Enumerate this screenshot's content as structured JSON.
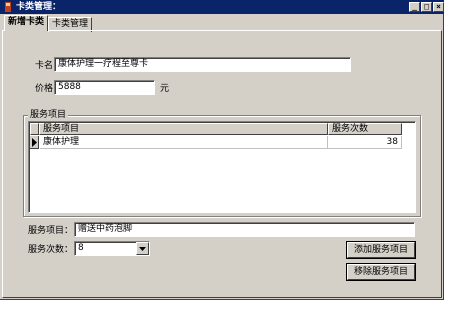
{
  "window": {
    "title": "卡类管理："
  },
  "tabs": [
    {
      "label": "新增卡类",
      "active": true
    },
    {
      "label": "卡类管理",
      "active": false
    }
  ],
  "form": {
    "card_name_label": "卡名：",
    "card_name_value": "康体护理一疗程至尊卡",
    "price_label": "价格：",
    "price_value": "5888",
    "price_unit": "元"
  },
  "services_group": {
    "title": "服务项目",
    "columns": [
      "服务项目",
      "服务次数"
    ],
    "rows": [
      {
        "item": "康体护理",
        "count": "38"
      }
    ]
  },
  "bottom": {
    "service_item_label": "服务项目：",
    "service_item_value": "赠送中药泡脚",
    "service_count_label": "服务次数：",
    "service_count_value": "8",
    "add_button": "添加服务项目",
    "remove_button": "移除服务项目"
  },
  "colors": {
    "titlebar": "#0a246a",
    "face": "#d4d0c8"
  }
}
